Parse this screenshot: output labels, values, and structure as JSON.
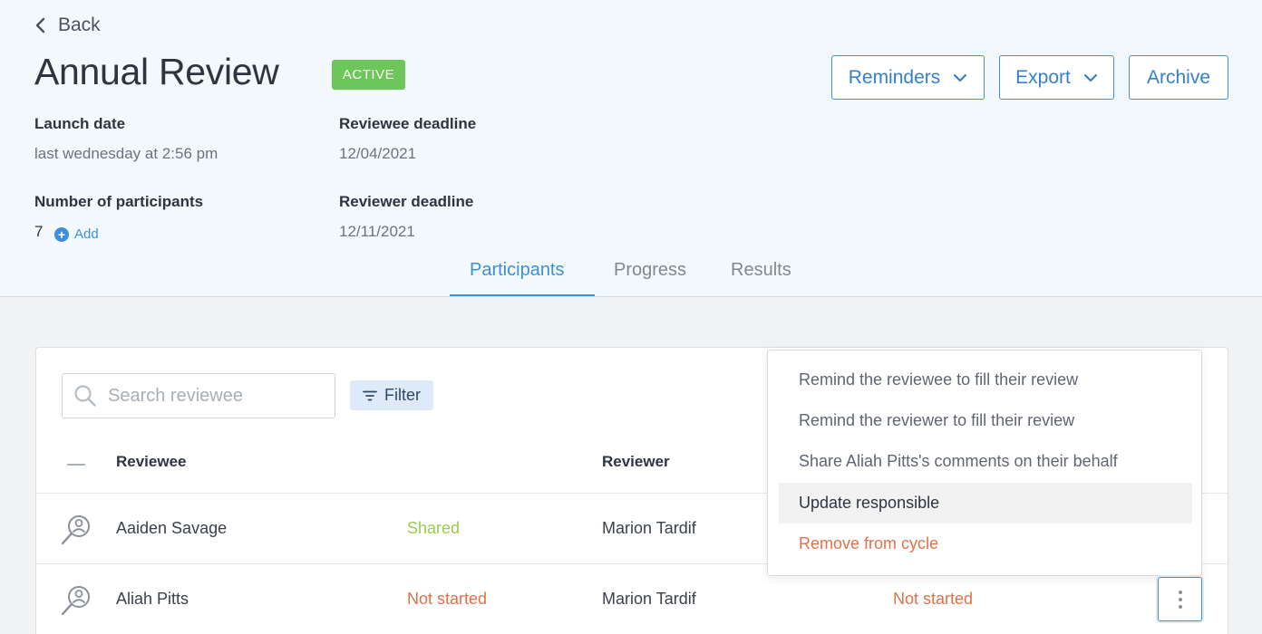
{
  "nav": {
    "back_label": "Back"
  },
  "review": {
    "title": "Annual Review",
    "status_badge": "ACTIVE",
    "launch_date_label": "Launch date",
    "launch_date_value": "last wednesday at 2:56 pm",
    "reviewee_deadline_label": "Reviewee deadline",
    "reviewee_deadline_value": "12/04/2021",
    "participants_label": "Number of participants",
    "participants_count": "7",
    "add_label": "Add",
    "reviewer_deadline_label": "Reviewer deadline",
    "reviewer_deadline_value": "12/11/2021"
  },
  "actions": {
    "reminders_label": "Reminders",
    "export_label": "Export",
    "archive_label": "Archive"
  },
  "tabs": [
    {
      "label": "Participants",
      "active": true
    },
    {
      "label": "Progress",
      "active": false
    },
    {
      "label": "Results",
      "active": false
    }
  ],
  "toolbar": {
    "search_placeholder": "Search reviewee",
    "filter_label": "Filter"
  },
  "table": {
    "columns": {
      "reviewee": "Reviewee",
      "reviewer": "Reviewer"
    },
    "rows": [
      {
        "reviewee": "Aaiden Savage",
        "reviewee_status": "Shared",
        "reviewer": "Marion Tardif",
        "reviewer_status": ""
      },
      {
        "reviewee": "Aliah Pitts",
        "reviewee_status": "Not started",
        "reviewer": "Marion Tardif",
        "reviewer_status": "Not started"
      }
    ]
  },
  "context_menu": {
    "items": [
      "Remind the reviewee to fill their review",
      "Remind the reviewer to fill their review",
      "Share Aliah Pitts's comments on their behalf",
      "Update responsible",
      "Remove from cycle"
    ]
  },
  "colors": {
    "accent": "#3d8fd6",
    "active_badge": "#6cc659",
    "status_shared": "#9ccc4a",
    "status_not_started": "#e0714a"
  }
}
